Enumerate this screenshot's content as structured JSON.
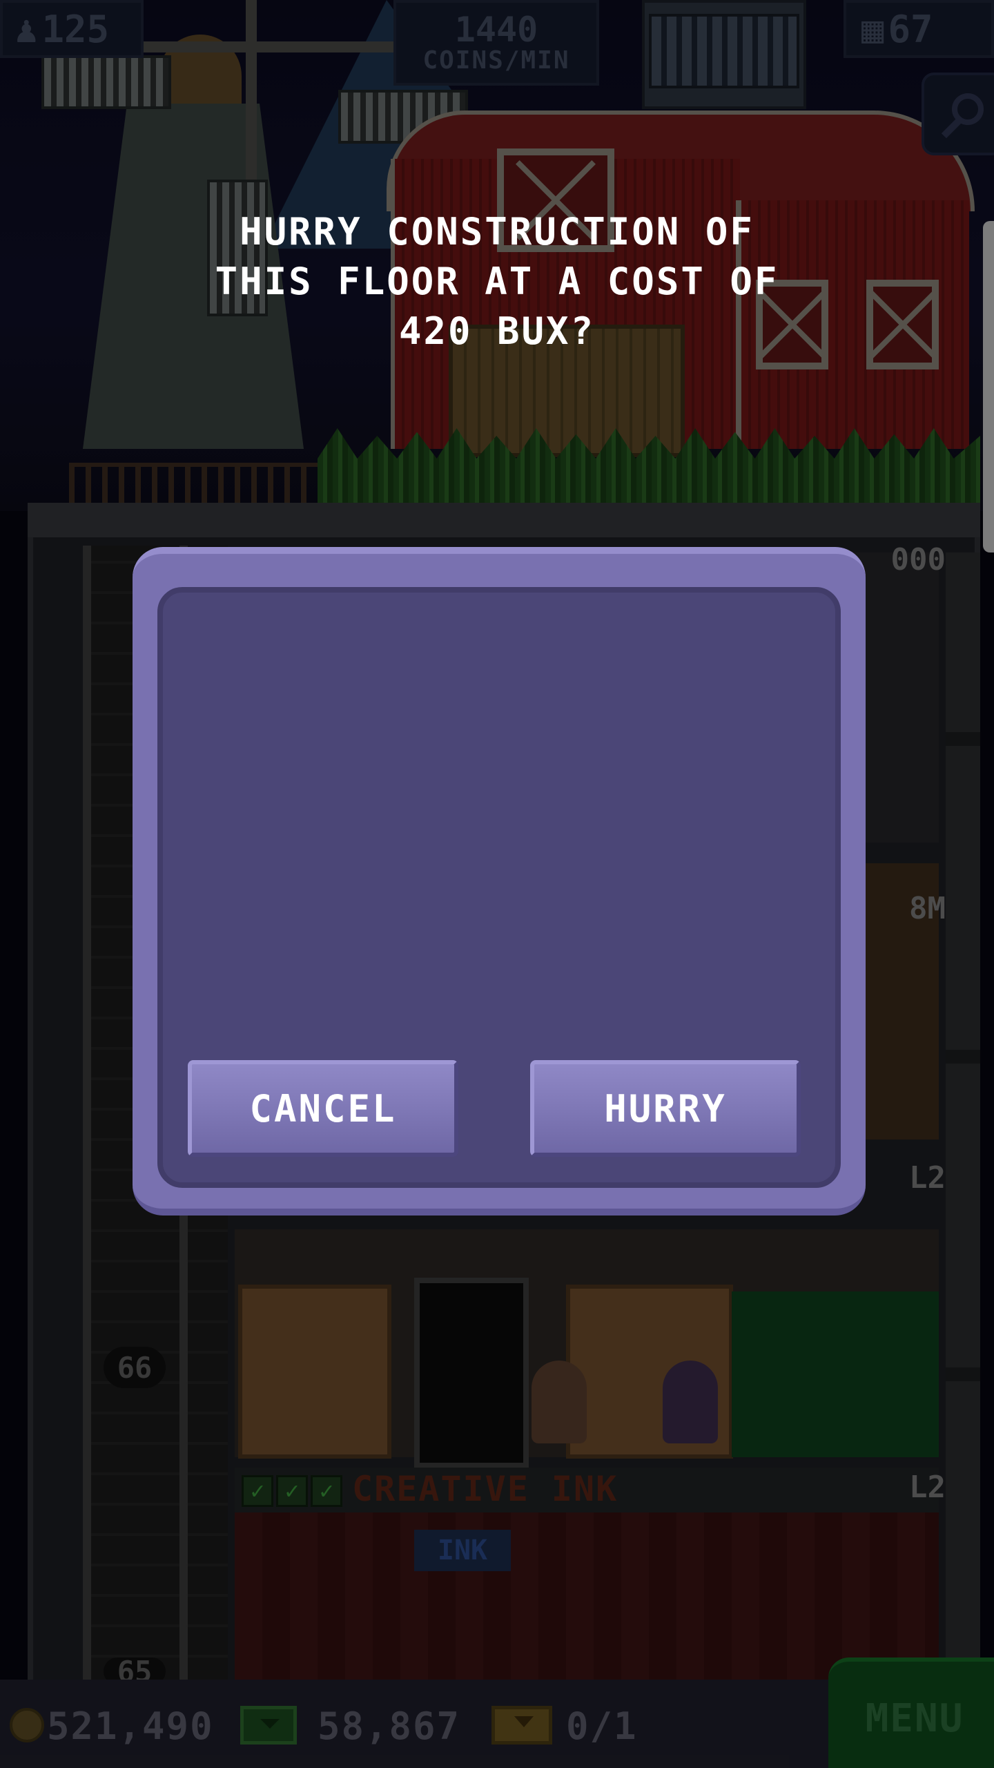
{
  "hud": {
    "population": "125",
    "coins_rate_value": "1440",
    "coins_rate_unit": "COINS/MIN",
    "floors": "67"
  },
  "dialog": {
    "message": "HURRY CONSTRUCTION OF\nTHIS FLOOR AT A COST OF\n420 BUX?",
    "cancel_label": "CANCEL",
    "confirm_label": "HURRY"
  },
  "tower": {
    "floor_numbers": [
      "66",
      "65"
    ],
    "floor_tags": [
      "000",
      "8M",
      "L2",
      "L2"
    ],
    "creative_ink_name": "CREATIVE INK",
    "ink_sign": "INK"
  },
  "bottom_bar": {
    "coins": "521,490",
    "bux": "58,867",
    "tickets": "0/1",
    "menu_label": "MENU"
  },
  "colors": {
    "dialog_outer": "#7971b0",
    "dialog_inner": "#4b4677",
    "button": "#7d76b6",
    "menu_green": "#0e4a1a"
  },
  "icons": [
    "person-icon",
    "building-icon",
    "search-icon",
    "coin-icon",
    "bux-icon",
    "ticket-icon"
  ]
}
